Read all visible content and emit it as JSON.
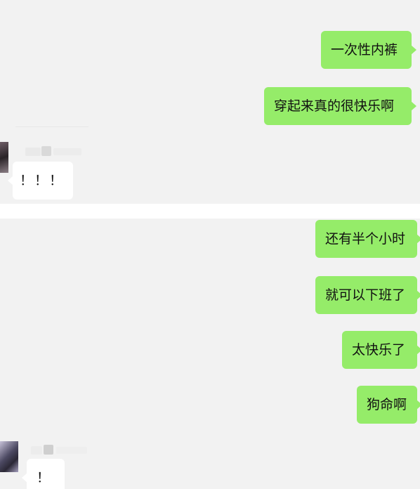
{
  "chat_segment_1": {
    "messages": [
      {
        "side": "sent",
        "text": "一次性内裤"
      },
      {
        "side": "sent",
        "text": "穿起来真的很快乐啊"
      },
      {
        "side": "received",
        "text": "！！！"
      }
    ]
  },
  "chat_segment_2": {
    "messages": [
      {
        "side": "sent",
        "text": "还有半个小时"
      },
      {
        "side": "sent",
        "text": "就可以下班了"
      },
      {
        "side": "sent",
        "text": "太快乐了"
      },
      {
        "side": "sent",
        "text": "狗命啊"
      },
      {
        "side": "received",
        "text": "！"
      }
    ]
  },
  "colors": {
    "chat_background": "#f2f2f2",
    "sent_bubble": "#95ec69",
    "received_bubble": "#ffffff",
    "text": "#111111"
  }
}
